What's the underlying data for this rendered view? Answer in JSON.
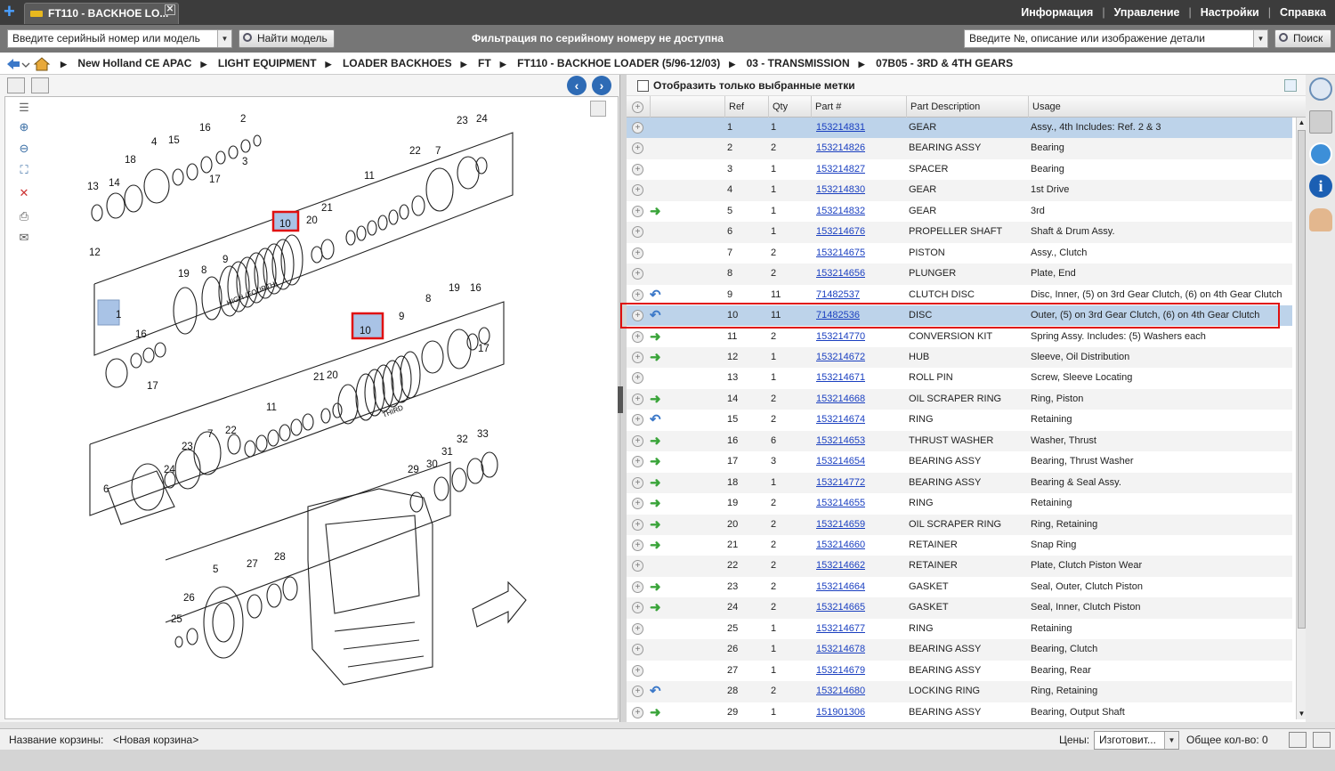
{
  "tab": {
    "title": "FT110 - BACKHOE LO...",
    "close": "✕"
  },
  "topmenu": [
    "Информация",
    "Управление",
    "Настройки",
    "Справка"
  ],
  "toolbar": {
    "serial_value": "Введите серийный номер или модель",
    "find_model_label": "Найти модель",
    "filter_note": "Фильтрация по серийному номеру не доступна",
    "part_search_value": "Введите №, описание или изображение детали",
    "search_label": "Поиск"
  },
  "breadcrumb": [
    "New Holland CE APAC",
    "LIGHT EQUIPMENT",
    "LOADER BACKHOES",
    "FT",
    "FT110 - BACKHOE LOADER (5/96-12/03)",
    "03 - TRANSMISSION",
    "07B05 - 3RD & 4TH GEARS"
  ],
  "filter": {
    "show_selected_label": "Отобразить только выбранные метки"
  },
  "table": {
    "headers": {
      "ref": "Ref",
      "qty": "Qty",
      "part": "Part #",
      "desc": "Part Description",
      "usage": "Usage"
    },
    "rows": [
      {
        "ref": "1",
        "qty": "1",
        "part": "153214831",
        "desc": "GEAR",
        "usage": "Assy., 4th Includes: Ref. 2 & 3",
        "arrow": "",
        "selected": true
      },
      {
        "ref": "2",
        "qty": "2",
        "part": "153214826",
        "desc": "BEARING ASSY",
        "usage": "Bearing",
        "arrow": ""
      },
      {
        "ref": "3",
        "qty": "1",
        "part": "153214827",
        "desc": "SPACER",
        "usage": "Bearing",
        "arrow": ""
      },
      {
        "ref": "4",
        "qty": "1",
        "part": "153214830",
        "desc": "GEAR",
        "usage": "1st Drive",
        "arrow": ""
      },
      {
        "ref": "5",
        "qty": "1",
        "part": "153214832",
        "desc": "GEAR",
        "usage": "3rd",
        "arrow": "green"
      },
      {
        "ref": "6",
        "qty": "1",
        "part": "153214676",
        "desc": "PROPELLER SHAFT",
        "usage": "Shaft & Drum Assy.",
        "arrow": ""
      },
      {
        "ref": "7",
        "qty": "2",
        "part": "153214675",
        "desc": "PISTON",
        "usage": "Assy., Clutch",
        "arrow": ""
      },
      {
        "ref": "8",
        "qty": "2",
        "part": "153214656",
        "desc": "PLUNGER",
        "usage": "Plate, End",
        "arrow": ""
      },
      {
        "ref": "9",
        "qty": "11",
        "part": "71482537",
        "desc": "CLUTCH DISC",
        "usage": "Disc, Inner, (5) on 3rd Gear Clutch, (6) on 4th Gear Clutch",
        "arrow": "blue"
      },
      {
        "ref": "10",
        "qty": "11",
        "part": "71482536",
        "desc": "DISC",
        "usage": "Outer, (5) on 3rd Gear Clutch, (6) on 4th Gear Clutch",
        "arrow": "blue",
        "selected": true
      },
      {
        "ref": "11",
        "qty": "2",
        "part": "153214770",
        "desc": "CONVERSION KIT",
        "usage": "Spring Assy. Includes: (5) Washers each",
        "arrow": "green"
      },
      {
        "ref": "12",
        "qty": "1",
        "part": "153214672",
        "desc": "HUB",
        "usage": "Sleeve, Oil Distribution",
        "arrow": "green"
      },
      {
        "ref": "13",
        "qty": "1",
        "part": "153214671",
        "desc": "ROLL PIN",
        "usage": "Screw, Sleeve Locating",
        "arrow": ""
      },
      {
        "ref": "14",
        "qty": "2",
        "part": "153214668",
        "desc": "OIL SCRAPER RING",
        "usage": "Ring, Piston",
        "arrow": "green"
      },
      {
        "ref": "15",
        "qty": "2",
        "part": "153214674",
        "desc": "RING",
        "usage": "Retaining",
        "arrow": "blue"
      },
      {
        "ref": "16",
        "qty": "6",
        "part": "153214653",
        "desc": "THRUST WASHER",
        "usage": "Washer, Thrust",
        "arrow": "green"
      },
      {
        "ref": "17",
        "qty": "3",
        "part": "153214654",
        "desc": "BEARING ASSY",
        "usage": "Bearing, Thrust Washer",
        "arrow": "green"
      },
      {
        "ref": "18",
        "qty": "1",
        "part": "153214772",
        "desc": "BEARING ASSY",
        "usage": "Bearing & Seal Assy.",
        "arrow": "green"
      },
      {
        "ref": "19",
        "qty": "2",
        "part": "153214655",
        "desc": "RING",
        "usage": "Retaining",
        "arrow": "green"
      },
      {
        "ref": "20",
        "qty": "2",
        "part": "153214659",
        "desc": "OIL SCRAPER RING",
        "usage": "Ring, Retaining",
        "arrow": "green"
      },
      {
        "ref": "21",
        "qty": "2",
        "part": "153214660",
        "desc": "RETAINER",
        "usage": "Snap Ring",
        "arrow": "green"
      },
      {
        "ref": "22",
        "qty": "2",
        "part": "153214662",
        "desc": "RETAINER",
        "usage": "Plate, Clutch Piston Wear",
        "arrow": ""
      },
      {
        "ref": "23",
        "qty": "2",
        "part": "153214664",
        "desc": "GASKET",
        "usage": "Seal, Outer, Clutch Piston",
        "arrow": "green"
      },
      {
        "ref": "24",
        "qty": "2",
        "part": "153214665",
        "desc": "GASKET",
        "usage": "Seal, Inner, Clutch Piston",
        "arrow": "green"
      },
      {
        "ref": "25",
        "qty": "1",
        "part": "153214677",
        "desc": "RING",
        "usage": "Retaining",
        "arrow": ""
      },
      {
        "ref": "26",
        "qty": "1",
        "part": "153214678",
        "desc": "BEARING ASSY",
        "usage": "Bearing, Clutch",
        "arrow": ""
      },
      {
        "ref": "27",
        "qty": "1",
        "part": "153214679",
        "desc": "BEARING ASSY",
        "usage": "Bearing, Rear",
        "arrow": ""
      },
      {
        "ref": "28",
        "qty": "2",
        "part": "153214680",
        "desc": "LOCKING RING",
        "usage": "Ring, Retaining",
        "arrow": "blue"
      },
      {
        "ref": "29",
        "qty": "1",
        "part": "151901306",
        "desc": "BEARING ASSY",
        "usage": "Bearing, Output Shaft",
        "arrow": "green"
      }
    ]
  },
  "drawing": {
    "labels": [
      "1",
      "2",
      "3",
      "4",
      "5",
      "6",
      "7",
      "8",
      "9",
      "10",
      "11",
      "12",
      "13",
      "14",
      "15",
      "16",
      "17",
      "18",
      "19",
      "20",
      "21",
      "22",
      "23",
      "24",
      "25",
      "26",
      "27",
      "28",
      "29",
      "30",
      "31",
      "32",
      "33"
    ],
    "text_high": "HIGH (FOURTH)",
    "text_third": "THIRD"
  },
  "status": {
    "cart_label": "Название корзины:",
    "cart_value": "<Новая корзина>",
    "prices_label": "Цены:",
    "prices_value": "Изготовит...",
    "total_label": "Общее кол-во: 0"
  }
}
